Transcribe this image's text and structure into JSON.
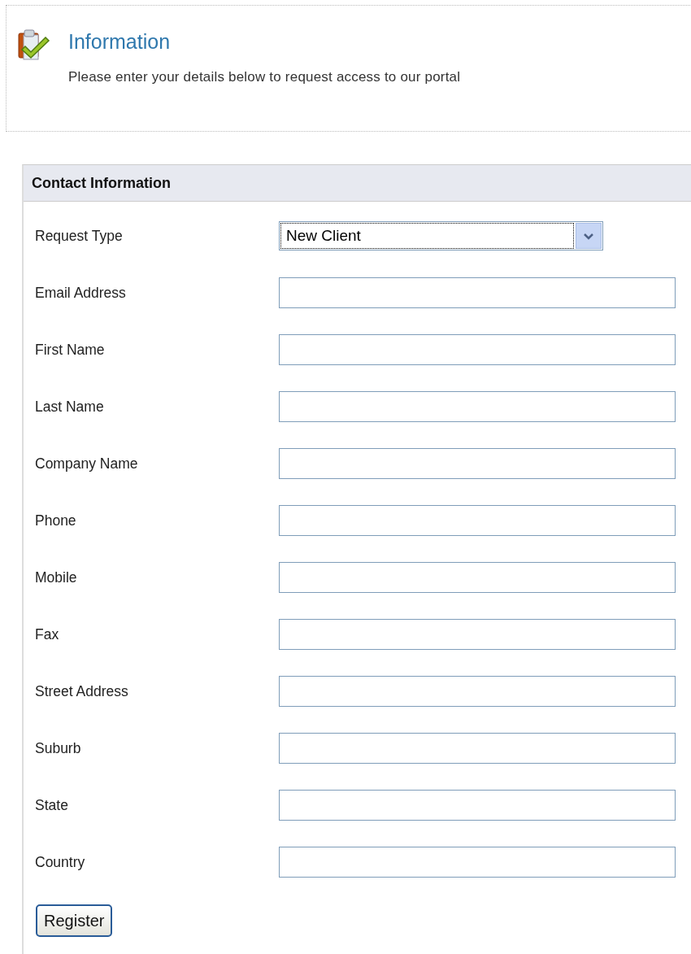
{
  "info": {
    "title": "Information",
    "message": "Please enter your details below to request access to our portal"
  },
  "form": {
    "title": "Contact Information",
    "fields": [
      {
        "kind": "select",
        "label": "Request Type",
        "value": "New Client"
      },
      {
        "kind": "text",
        "label": "Email Address"
      },
      {
        "kind": "text",
        "label": "First Name"
      },
      {
        "kind": "text",
        "label": "Last Name"
      },
      {
        "kind": "text",
        "label": "Company Name"
      },
      {
        "kind": "text",
        "label": "Phone"
      },
      {
        "kind": "text",
        "label": "Mobile"
      },
      {
        "kind": "text",
        "label": "Fax"
      },
      {
        "kind": "text",
        "label": "Street Address"
      },
      {
        "kind": "text",
        "label": "Suburb"
      },
      {
        "kind": "text",
        "label": "State"
      },
      {
        "kind": "text",
        "label": "Country"
      }
    ],
    "submit": "Register"
  }
}
